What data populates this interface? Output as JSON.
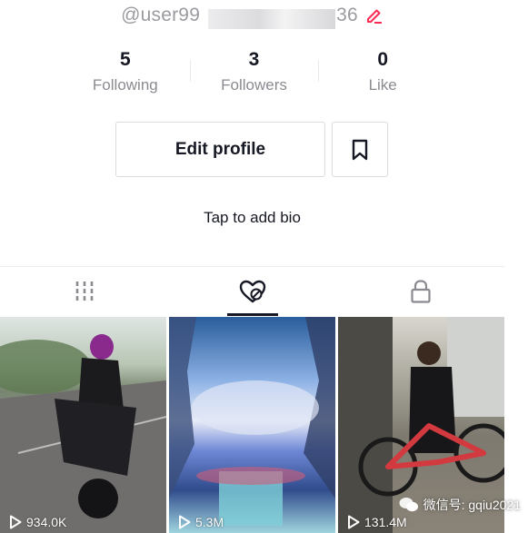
{
  "profile": {
    "username": "@user99",
    "username_suffix": "36",
    "stats": [
      {
        "value": "5",
        "label": "Following"
      },
      {
        "value": "3",
        "label": "Followers"
      },
      {
        "value": "0",
        "label": "Like"
      }
    ],
    "edit_profile_label": "Edit profile",
    "bio_placeholder": "Tap to add bio"
  },
  "tabs": [
    {
      "icon": "grid-icon",
      "active": false
    },
    {
      "icon": "liked-heart-icon",
      "active": true
    },
    {
      "icon": "lock-icon",
      "active": false
    }
  ],
  "videos": [
    {
      "views": "934.0K"
    },
    {
      "views": "5.3M"
    },
    {
      "views": "131.4M"
    }
  ],
  "watermark": {
    "text": "微信号: gqiu2021"
  },
  "colors": {
    "accent": "#fe2c55",
    "text": "#161823",
    "muted": "#8a8b91"
  }
}
